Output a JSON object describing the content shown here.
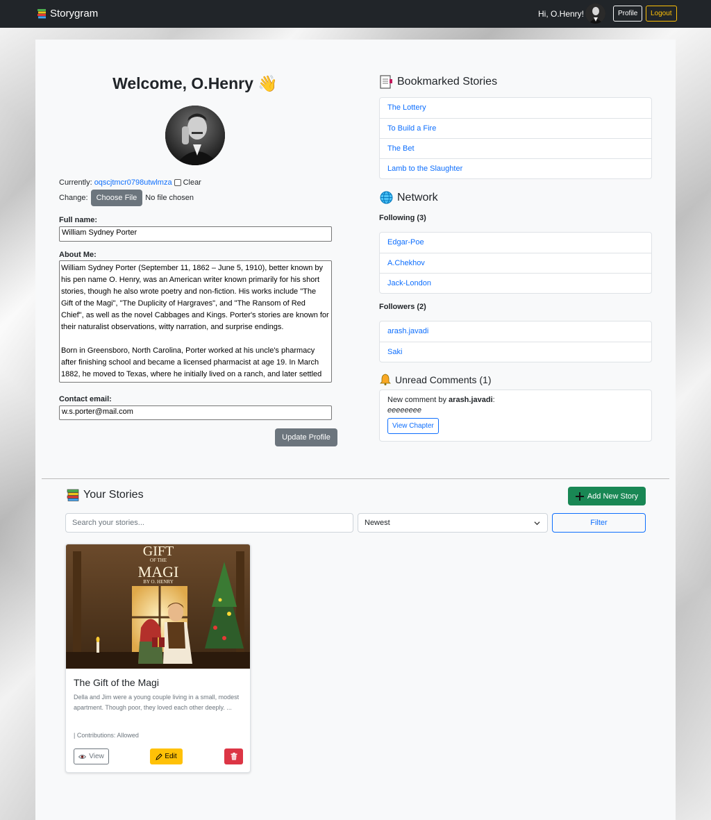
{
  "navbar": {
    "brand": "Storygram",
    "greeting": "Hi, O.Henry!",
    "profile_label": "Profile",
    "logout_label": "Logout"
  },
  "profile": {
    "welcome": "Welcome, O.Henry 👋",
    "currently_label": "Currently:",
    "current_file": "oqscjtmcr0798utwlmza",
    "clear_label": "Clear",
    "change_label": "Change:",
    "choose_file_label": "Choose File",
    "no_file_text": "No file chosen",
    "full_name_label": "Full name:",
    "full_name_value": "William Sydney Porter",
    "about_label": "About Me:",
    "about_value": "William Sydney Porter (September 11, 1862 – June 5, 1910), better known by his pen name O. Henry, was an American writer known primarily for his short stories, though he also wrote poetry and non-fiction. His works include \"The Gift of the Magi\", \"The Duplicity of Hargraves\", and \"The Ransom of Red Chief\", as well as the novel Cabbages and Kings. Porter's stories are known for their naturalist observations, witty narration, and surprise endings.\n\nBorn in Greensboro, North Carolina, Porter worked at his uncle's pharmacy after finishing school and became a licensed pharmacist at age 19. In March 1882, he moved to Texas, where he initially lived on a ranch, and later settled",
    "email_label": "Contact email:",
    "email_value": "w.s.porter@mail.com",
    "update_label": "Update Profile"
  },
  "bookmarks": {
    "title": "Bookmarked Stories",
    "items": [
      "The Lottery",
      "To Build a Fire",
      "The Bet",
      "Lamb to the Slaughter"
    ]
  },
  "network": {
    "title": "Network",
    "following_label": "Following (3)",
    "following": [
      "Edgar-Poe",
      "A.Chekhov",
      "Jack-London"
    ],
    "followers_label": "Followers (2)",
    "followers": [
      "arash.javadi",
      "Saki"
    ]
  },
  "comments": {
    "title": "Unread Comments (1)",
    "prefix": "New comment by",
    "author": "arash.javadi",
    "suffix": ":",
    "text": "eeeeeeee",
    "view_label": "View Chapter"
  },
  "stories": {
    "title": "Your Stories",
    "add_label": "Add New Story",
    "search_placeholder": "Search your stories...",
    "sort_value": "Newest",
    "filter_label": "Filter",
    "cards": [
      {
        "cover_title_top": "GIFT",
        "cover_title_mid": "OF THE",
        "cover_title_bottom": "MAGI",
        "cover_author": "BY O. HENRY",
        "title": "The Gift of the Magi",
        "description": "Della and Jim were a young couple living in a small, modest apartment. Though poor, they loved each other deeply. ...",
        "contributions": "| Contributions: Allowed",
        "view_label": "View",
        "edit_label": "Edit"
      }
    ]
  },
  "colors": {
    "navbar": "#212529",
    "primary": "#0d6efd",
    "success": "#198754",
    "warning": "#ffc107",
    "danger": "#dc3545",
    "secondary": "#6c757d"
  }
}
